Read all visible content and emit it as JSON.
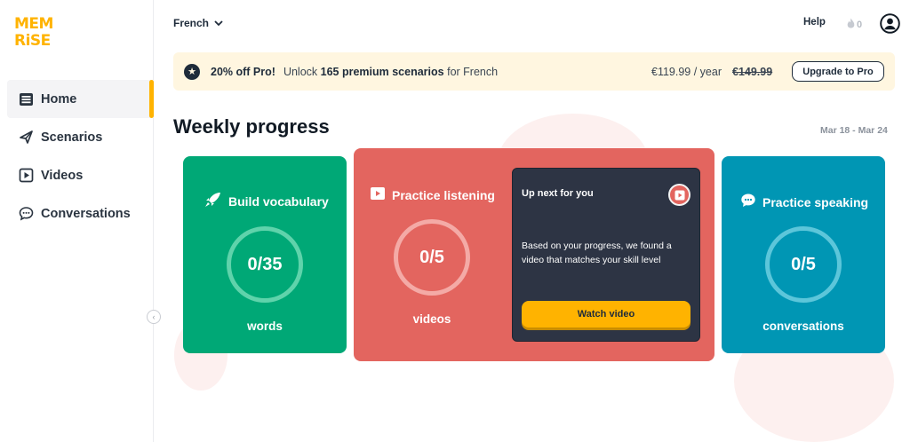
{
  "brand": {
    "logo_line1": "MEM",
    "logo_line2": "RiSE"
  },
  "sidebar": {
    "items": [
      {
        "label": "Home",
        "icon": "home-icon",
        "active": true
      },
      {
        "label": "Scenarios",
        "icon": "scenarios-icon",
        "active": false
      },
      {
        "label": "Videos",
        "icon": "videos-icon",
        "active": false
      },
      {
        "label": "Conversations",
        "icon": "conversations-icon",
        "active": false
      }
    ],
    "collapse_glyph": "‹"
  },
  "header": {
    "language": "French",
    "help": "Help",
    "streak_count": "0"
  },
  "promo": {
    "highlight": "20% off Pro!",
    "text_prefix": "Unlock",
    "text_bold": "165 premium scenarios",
    "text_suffix": "for French",
    "price": "€119.99 / year",
    "old_price": "€149.99",
    "button": "Upgrade to Pro"
  },
  "main": {
    "title": "Weekly progress",
    "date_range": "Mar 18 - Mar 24"
  },
  "cards": {
    "vocab": {
      "title": "Build vocabulary",
      "value": "0/35",
      "unit": "words",
      "color": "#00a876"
    },
    "listen": {
      "title": "Practice listening",
      "value": "0/5",
      "unit": "videos",
      "color": "#e3655f",
      "upnext_title": "Up next for you",
      "upnext_text": "Based on your progress, we found a video that matches your skill level",
      "upnext_button": "Watch video"
    },
    "speak": {
      "title": "Practice speaking",
      "value": "0/5",
      "unit": "conversations",
      "color": "#0096b4"
    }
  },
  "colors": {
    "accent": "#ffb300",
    "text": "#1e2b3a",
    "promo_bg": "#fff6e0"
  }
}
